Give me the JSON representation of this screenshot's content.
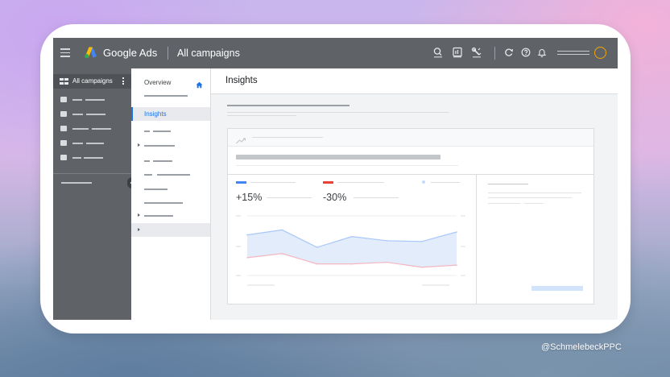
{
  "topbar": {
    "brand": "Google Ads",
    "title": "All campaigns",
    "icons": [
      "menu-icon",
      "google-ads-logo-icon",
      "search-icon",
      "reports-icon",
      "tools-icon",
      "refresh-icon",
      "help-icon",
      "notifications-icon"
    ],
    "avatar_color": "#f2a600"
  },
  "sidebar": {
    "header_label": "All campaigns",
    "item_count": 5
  },
  "subnav": {
    "overview_label": "Overview",
    "active_label": "Insights",
    "accent_color": "#1a73e8"
  },
  "main": {
    "title": "Insights",
    "metrics": [
      {
        "value": "+15%",
        "color": "#4285f4"
      },
      {
        "value": "-30%",
        "color": "#ea4335"
      },
      {
        "value": "",
        "color": "#c6dafc"
      }
    ]
  },
  "chart_data": {
    "type": "line",
    "title": "",
    "xlabel": "",
    "ylabel": "",
    "x": [
      1,
      2,
      3,
      4,
      5,
      6,
      7
    ],
    "series": [
      {
        "values": [
          0.78,
          0.9,
          0.48,
          0.74,
          0.64,
          0.62,
          0.85
        ],
        "color": "#a8c7fa",
        "fill": "#e3ecfb"
      },
      {
        "values": [
          0.23,
          0.33,
          0.08,
          0.08,
          0.12,
          0.0,
          0.05
        ],
        "color": "#f4b6c2"
      }
    ],
    "ylim": [
      -0.2,
      1.2
    ],
    "grid": true
  },
  "watermark": "@SchmelebeckPPC"
}
